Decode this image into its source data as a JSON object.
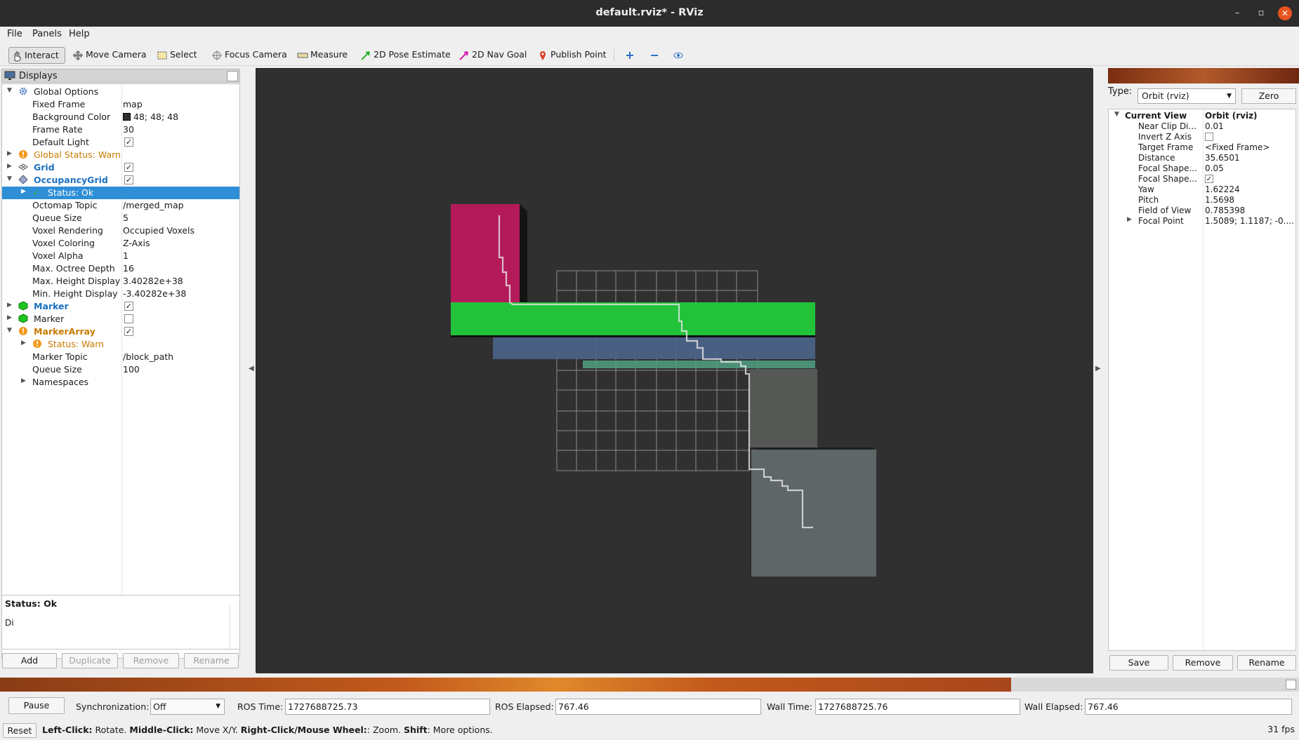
{
  "window": {
    "title": "default.rviz* - RViz"
  },
  "menu": [
    "File",
    "Panels",
    "Help"
  ],
  "toolbar": {
    "tools": [
      "Interact",
      "Move Camera",
      "Select",
      "Focus Camera",
      "Measure",
      "2D Pose Estimate",
      "2D Nav Goal",
      "Publish Point"
    ]
  },
  "displays": {
    "title": "Displays",
    "rows": [
      {
        "k": "Global Options",
        "v": ""
      },
      {
        "k": "Fixed Frame",
        "v": "map"
      },
      {
        "k": "Background Color",
        "v": "48; 48; 48"
      },
      {
        "k": "Frame Rate",
        "v": "30"
      },
      {
        "k": "Default Light",
        "v": ""
      },
      {
        "k": "Global Status: Warn",
        "v": ""
      },
      {
        "k": "Grid",
        "v": ""
      },
      {
        "k": "OccupancyGrid",
        "v": ""
      },
      {
        "k": "Status: Ok",
        "v": ""
      },
      {
        "k": "Octomap Topic",
        "v": "/merged_map"
      },
      {
        "k": "Queue Size",
        "v": "5"
      },
      {
        "k": "Voxel Rendering",
        "v": "Occupied Voxels"
      },
      {
        "k": "Voxel Coloring",
        "v": "Z-Axis"
      },
      {
        "k": "Voxel Alpha",
        "v": "1"
      },
      {
        "k": "Max. Octree Depth",
        "v": "16"
      },
      {
        "k": "Max. Height Display",
        "v": "3.40282e+38"
      },
      {
        "k": "Min. Height Display",
        "v": "-3.40282e+38"
      },
      {
        "k": "Marker",
        "v": ""
      },
      {
        "k": "Marker",
        "v": ""
      },
      {
        "k": "MarkerArray",
        "v": ""
      },
      {
        "k": "Status: Warn",
        "v": ""
      },
      {
        "k": "Marker Topic",
        "v": "/block_path"
      },
      {
        "k": "Queue Size",
        "v": "100"
      },
      {
        "k": "Namespaces",
        "v": ""
      }
    ],
    "status_title": "Status: Ok",
    "status_desc": "Di",
    "buttons": [
      "Add",
      "Duplicate",
      "Remove",
      "Rename"
    ]
  },
  "views": {
    "type_label": "Type:",
    "type_value": "Orbit (rviz)",
    "zero": "Zero",
    "rows": [
      {
        "k": "Current View",
        "v": "Orbit (rviz)"
      },
      {
        "k": "Near Clip Di...",
        "v": "0.01"
      },
      {
        "k": "Invert Z Axis",
        "v": ""
      },
      {
        "k": "Target Frame",
        "v": "<Fixed Frame>"
      },
      {
        "k": "Distance",
        "v": "35.6501"
      },
      {
        "k": "Focal Shape...",
        "v": "0.05"
      },
      {
        "k": "Focal Shape...",
        "v": ""
      },
      {
        "k": "Yaw",
        "v": "1.62224"
      },
      {
        "k": "Pitch",
        "v": "1.5698"
      },
      {
        "k": "Field of View",
        "v": "0.785398"
      },
      {
        "k": "Focal Point",
        "v": "1.5089; 1.1187; -0...."
      }
    ],
    "buttons": [
      "Save",
      "Remove",
      "Rename"
    ]
  },
  "time": {
    "pause": "Pause",
    "sync_label": "Synchronization:",
    "sync_value": "Off",
    "ros_time_label": "ROS Time:",
    "ros_time": "1727688725.73",
    "ros_elapsed_label": "ROS Elapsed:",
    "ros_elapsed": "767.46",
    "wall_time_label": "Wall Time:",
    "wall_time": "1727688725.76",
    "wall_elapsed_label": "Wall Elapsed:",
    "wall_elapsed": "767.46"
  },
  "hint": {
    "reset": "Reset",
    "b1": "Left-Click:",
    "t1": " Rotate. ",
    "b2": "Middle-Click:",
    "t2": " Move X/Y. ",
    "b3": "Right-Click/Mouse Wheel:",
    "t3": ": Zoom. ",
    "b4": "Shift",
    "t4": ": More options.",
    "fps": "31 fps"
  },
  "colors": {
    "background": "#303030",
    "selection": "#2f8fd6",
    "warn": "#c87b00",
    "display_name": "#1c6fbf"
  }
}
